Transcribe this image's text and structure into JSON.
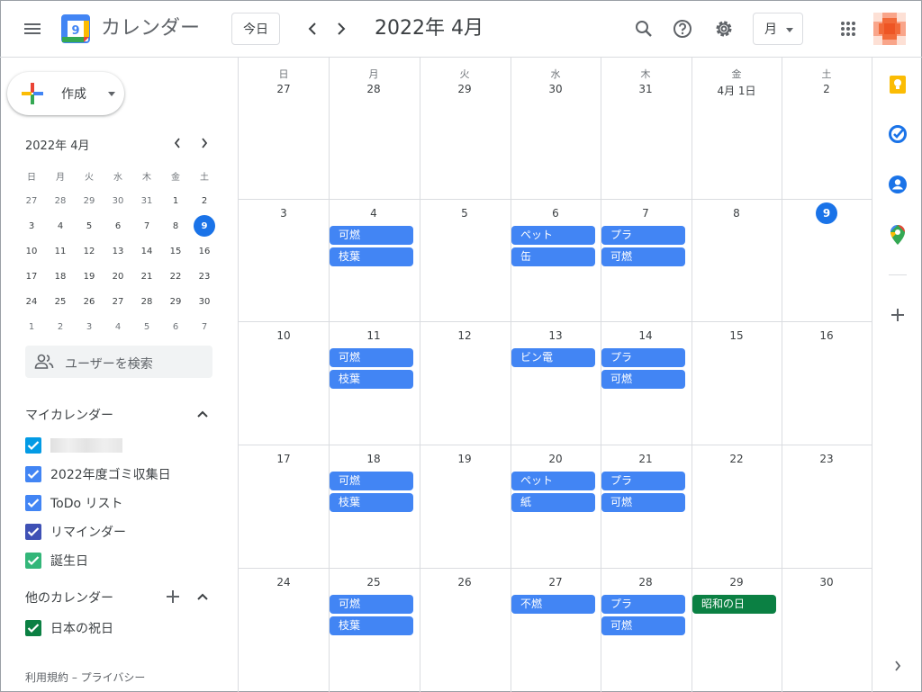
{
  "header": {
    "app_title": "カレンダー",
    "logo_day": "9",
    "today_label": "今日",
    "period": "2022年 4月",
    "view_label": "月"
  },
  "sidebar": {
    "create_label": "作成",
    "mini_title": "2022年 4月",
    "mini_weekdays": [
      "日",
      "月",
      "火",
      "水",
      "木",
      "金",
      "土"
    ],
    "mini_weeks": [
      [
        "27",
        "28",
        "29",
        "30",
        "31",
        "1",
        "2"
      ],
      [
        "3",
        "4",
        "5",
        "6",
        "7",
        "8",
        "9"
      ],
      [
        "10",
        "11",
        "12",
        "13",
        "14",
        "15",
        "16"
      ],
      [
        "17",
        "18",
        "19",
        "20",
        "21",
        "22",
        "23"
      ],
      [
        "24",
        "25",
        "26",
        "27",
        "28",
        "29",
        "30"
      ],
      [
        "1",
        "2",
        "3",
        "4",
        "5",
        "6",
        "7"
      ]
    ],
    "search_people_placeholder": "ユーザーを検索",
    "my_calendars_title": "マイカレンダー",
    "my_calendars": [
      {
        "label": "",
        "color": "#039be5",
        "blurred": true
      },
      {
        "label": "2022年度ゴミ収集日",
        "color": "#4285f4"
      },
      {
        "label": "ToDo リスト",
        "color": "#4285f4"
      },
      {
        "label": "リマインダー",
        "color": "#3f51b5"
      },
      {
        "label": "誕生日",
        "color": "#33b679"
      }
    ],
    "other_calendars_title": "他のカレンダー",
    "other_calendars": [
      {
        "label": "日本の祝日",
        "color": "#0b8043"
      }
    ],
    "footer": "利用規約 – プライバシー"
  },
  "month": {
    "weekdays": [
      "日",
      "月",
      "火",
      "水",
      "木",
      "金",
      "土"
    ],
    "weeks": [
      [
        "27",
        "28",
        "29",
        "30",
        "31",
        "4月 1日",
        "2"
      ],
      [
        "3",
        "4",
        "5",
        "6",
        "7",
        "8",
        "9"
      ],
      [
        "10",
        "11",
        "12",
        "13",
        "14",
        "15",
        "16"
      ],
      [
        "17",
        "18",
        "19",
        "20",
        "21",
        "22",
        "23"
      ],
      [
        "24",
        "25",
        "26",
        "27",
        "28",
        "29",
        "30"
      ]
    ],
    "today": "9",
    "events": [
      {
        "week": 1,
        "day": 1,
        "slot": 0,
        "title": "可燃"
      },
      {
        "week": 1,
        "day": 1,
        "slot": 1,
        "title": "枝葉"
      },
      {
        "week": 1,
        "day": 3,
        "slot": 0,
        "title": "ペット"
      },
      {
        "week": 1,
        "day": 3,
        "slot": 1,
        "title": "缶"
      },
      {
        "week": 1,
        "day": 4,
        "slot": 0,
        "title": "プラ"
      },
      {
        "week": 1,
        "day": 4,
        "slot": 1,
        "title": "可燃"
      },
      {
        "week": 2,
        "day": 1,
        "slot": 0,
        "title": "可燃"
      },
      {
        "week": 2,
        "day": 1,
        "slot": 1,
        "title": "枝葉"
      },
      {
        "week": 2,
        "day": 3,
        "slot": 0,
        "title": "ビン電"
      },
      {
        "week": 2,
        "day": 4,
        "slot": 0,
        "title": "プラ"
      },
      {
        "week": 2,
        "day": 4,
        "slot": 1,
        "title": "可燃"
      },
      {
        "week": 3,
        "day": 1,
        "slot": 0,
        "title": "可燃"
      },
      {
        "week": 3,
        "day": 1,
        "slot": 1,
        "title": "枝葉"
      },
      {
        "week": 3,
        "day": 3,
        "slot": 0,
        "title": "ペット"
      },
      {
        "week": 3,
        "day": 3,
        "slot": 1,
        "title": "紙"
      },
      {
        "week": 3,
        "day": 4,
        "slot": 0,
        "title": "プラ"
      },
      {
        "week": 3,
        "day": 4,
        "slot": 1,
        "title": "可燃"
      },
      {
        "week": 4,
        "day": 1,
        "slot": 0,
        "title": "可燃"
      },
      {
        "week": 4,
        "day": 1,
        "slot": 1,
        "title": "枝葉"
      },
      {
        "week": 4,
        "day": 3,
        "slot": 0,
        "title": "不燃"
      },
      {
        "week": 4,
        "day": 4,
        "slot": 0,
        "title": "プラ"
      },
      {
        "week": 4,
        "day": 4,
        "slot": 1,
        "title": "可燃"
      },
      {
        "week": 4,
        "day": 5,
        "slot": 0,
        "title": "昭和の日",
        "color": "#0b8043"
      }
    ]
  },
  "colors": {
    "accent": "#1a73e8",
    "event_blue": "#4285f4",
    "holiday_green": "#0b8043"
  },
  "right_panel": [
    "keep-icon",
    "tasks-icon",
    "contacts-icon",
    "maps-icon",
    "add-icon"
  ]
}
